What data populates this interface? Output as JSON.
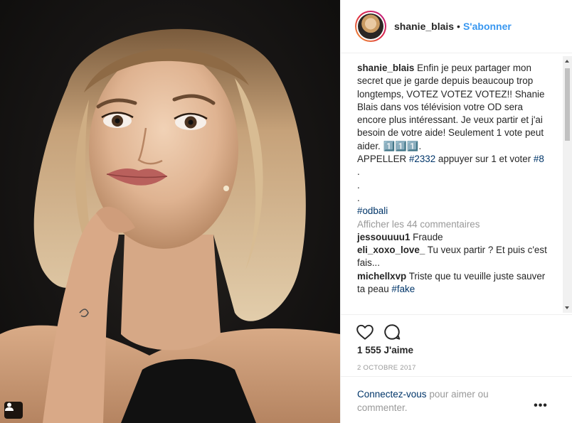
{
  "header": {
    "username": "shanie_blais",
    "separator": "•",
    "follow_label": "S'abonner"
  },
  "caption": {
    "username": "shanie_blais",
    "text": "Enfin je peux partager mon secret que je garde depuis beaucoup trop longtemps, VOTEZ VOTEZ VOTEZ!! Shanie Blais dans vos télévision votre OD sera encore plus intéressant. Je veux partir et j'ai besoin de votre aide! Seulement 1 vote peut aider. 1️⃣1️⃣1️⃣.",
    "line2_prefix": "APPELLER ",
    "line2_tag1": "#2332",
    "line2_middle": " appuyer sur 1 et voter ",
    "line2_tag2": "#8",
    "dot1": ".",
    "dot2": ".",
    "dot3": ".",
    "hashtag": "#odbali"
  },
  "view_all_comments": "Afficher les 44 commentaires",
  "comments": [
    {
      "username": "jessouuuu1",
      "text": "Fraude"
    },
    {
      "username": "eli_xoxo_love_",
      "text": "Tu veux partir ? Et puis c'est fais..."
    },
    {
      "username": "michellxvp",
      "text": "Triste que tu veuille juste sauver ta peau ",
      "tag": "#fake"
    }
  ],
  "likes": "1 555 J'aime",
  "date": "2 OCTOBRE 2017",
  "login": {
    "link": "Connectez-vous",
    "rest": " pour aimer ou commenter."
  },
  "more_label": "•••",
  "icons": {
    "like": "heart-icon",
    "comment": "comment-bubble-icon",
    "tag": "user-tag-icon",
    "scroll_up": "scroll-up-arrow",
    "scroll_down": "scroll-down-arrow"
  },
  "colors": {
    "link_blue": "#3897f0",
    "hashtag": "#003569",
    "muted": "#999999",
    "text": "#262626"
  }
}
